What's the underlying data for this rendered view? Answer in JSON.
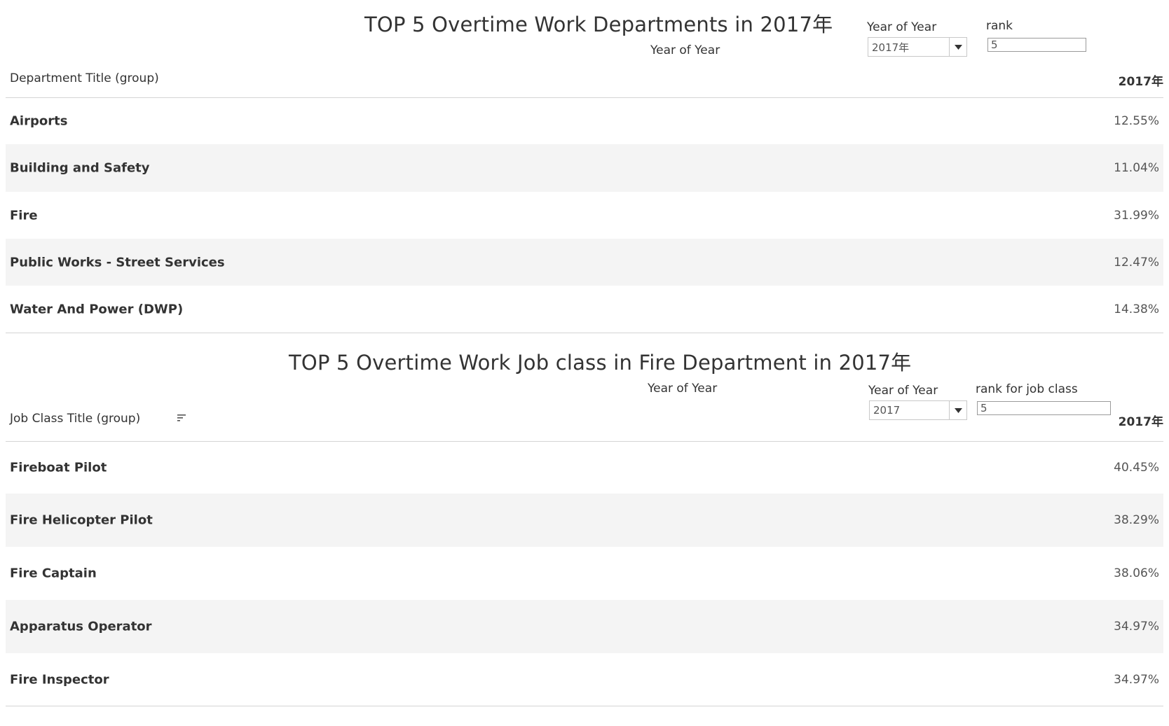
{
  "section1": {
    "title": "TOP 5 Overtime Work Departments in 2017年",
    "column_header_label": "Year of Year",
    "filter_year": {
      "label": "Year of Year",
      "value": "2017年"
    },
    "filter_rank": {
      "label": "rank",
      "value": "5"
    },
    "row_header": "Department Title (group)",
    "year_header": "2017年",
    "rows": [
      {
        "label": "Airports",
        "value": "12.55%"
      },
      {
        "label": "Building and Safety",
        "value": "11.04%"
      },
      {
        "label": "Fire",
        "value": "31.99%"
      },
      {
        "label": "Public Works - Street Services",
        "value": "12.47%"
      },
      {
        "label": "Water And Power (DWP)",
        "value": "14.38%"
      }
    ]
  },
  "section2": {
    "title": "TOP 5 Overtime Work Job class in Fire Department in 2017年",
    "column_header_label": "Year of Year",
    "filter_year": {
      "label": "Year of Year",
      "value": "2017"
    },
    "filter_rank": {
      "label": "rank for job class",
      "value": "5"
    },
    "row_header": "Job Class Title (group)",
    "sort_icon": "sort-descending-icon",
    "year_header": "2017年",
    "rows": [
      {
        "label": "Fireboat Pilot",
        "value": "40.45%"
      },
      {
        "label": "Fire Helicopter Pilot",
        "value": "38.29%"
      },
      {
        "label": "Fire Captain",
        "value": "38.06%"
      },
      {
        "label": "Apparatus Operator",
        "value": "34.97%"
      },
      {
        "label": "Fire Inspector",
        "value": "34.97%"
      }
    ]
  },
  "colors": {
    "text": "#333333",
    "value_text": "#555555",
    "alt_row": "#f4f4f4",
    "divider": "#d4d4d4"
  }
}
